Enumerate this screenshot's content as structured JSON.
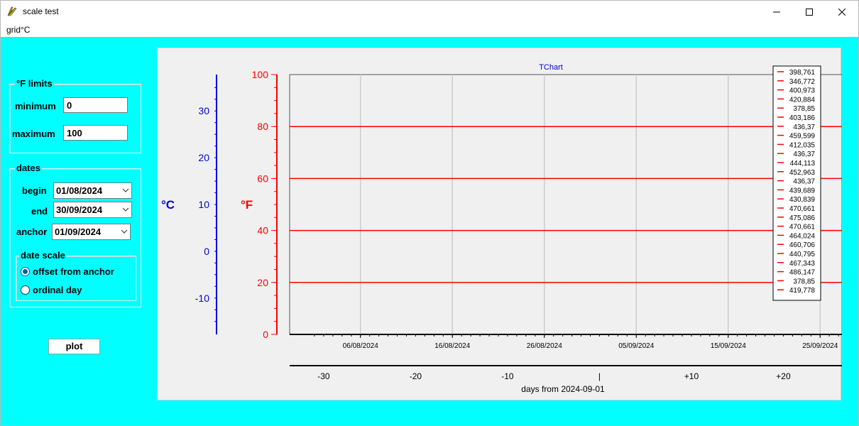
{
  "window": {
    "title": "scale test"
  },
  "menu": {
    "item": "grid°C"
  },
  "limits": {
    "group_title": "°F limits",
    "minimum_label": "minimum",
    "minimum_value": "0",
    "maximum_label": "maximum",
    "maximum_value": "100"
  },
  "dates": {
    "group_title": "dates",
    "begin_label": "begin",
    "begin_value": "01/08/2024",
    "end_label": "end",
    "end_value": "30/09/2024",
    "anchor_label": "anchor",
    "anchor_value": "01/09/2024"
  },
  "date_scale": {
    "group_title": "date scale",
    "options": [
      {
        "label": "offset from anchor",
        "selected": true
      },
      {
        "label": "ordinal day",
        "selected": false
      }
    ]
  },
  "plot_button": {
    "label": "plot"
  },
  "chart": {
    "title": "TChart",
    "left_axis_c": {
      "label": "°C",
      "ticks": [
        "30",
        "20",
        "10",
        "0",
        "-10"
      ],
      "color": "#0000dd"
    },
    "left_axis_f": {
      "label": "°F",
      "ticks": [
        "100",
        "80",
        "60",
        "40",
        "20",
        "0"
      ],
      "color": "#ff0000"
    },
    "date_ticks": [
      "06/08/2024",
      "16/08/2024",
      "26/08/2024",
      "05/09/2024",
      "15/09/2024",
      "25/09/2024"
    ],
    "offset_ticks": [
      "-30",
      "-20",
      "-10",
      "|",
      "+10",
      "+20"
    ],
    "offset_axis_title": "days from 2024-09-01",
    "legend_entries": [
      "398,761",
      "346,772",
      "400,973",
      "420,884",
      "378,85",
      "403,186",
      "436,37",
      "459,599",
      "412,035",
      "436,37",
      "444,113",
      "452,963",
      "436,37",
      "439,689",
      "430,839",
      "470,661",
      "475,086",
      "470,661",
      "464,024",
      "460,706",
      "440,795",
      "467,343",
      "486,147",
      "378,85",
      "419,778"
    ],
    "series_color": "#ff0000",
    "grid_color": "#cccccc"
  },
  "chart_data": {
    "type": "line",
    "title": "TChart",
    "xlabel": "days from 2024-09-01",
    "ylabel": "°F",
    "ylim": [
      0,
      100
    ],
    "y2label": "°C",
    "y2lim": [
      -17.78,
      37.78
    ],
    "xlim": [
      "2024-08-01",
      "2024-09-30"
    ],
    "x_ticks": [
      "06/08/2024",
      "16/08/2024",
      "26/08/2024",
      "05/09/2024",
      "15/09/2024",
      "25/09/2024"
    ],
    "x2_ticks": [
      -30,
      -20,
      -10,
      0,
      10,
      20
    ],
    "horizontal_lines_f": [
      20,
      40,
      60,
      80
    ],
    "grid": true,
    "legend_position": "top-right"
  }
}
